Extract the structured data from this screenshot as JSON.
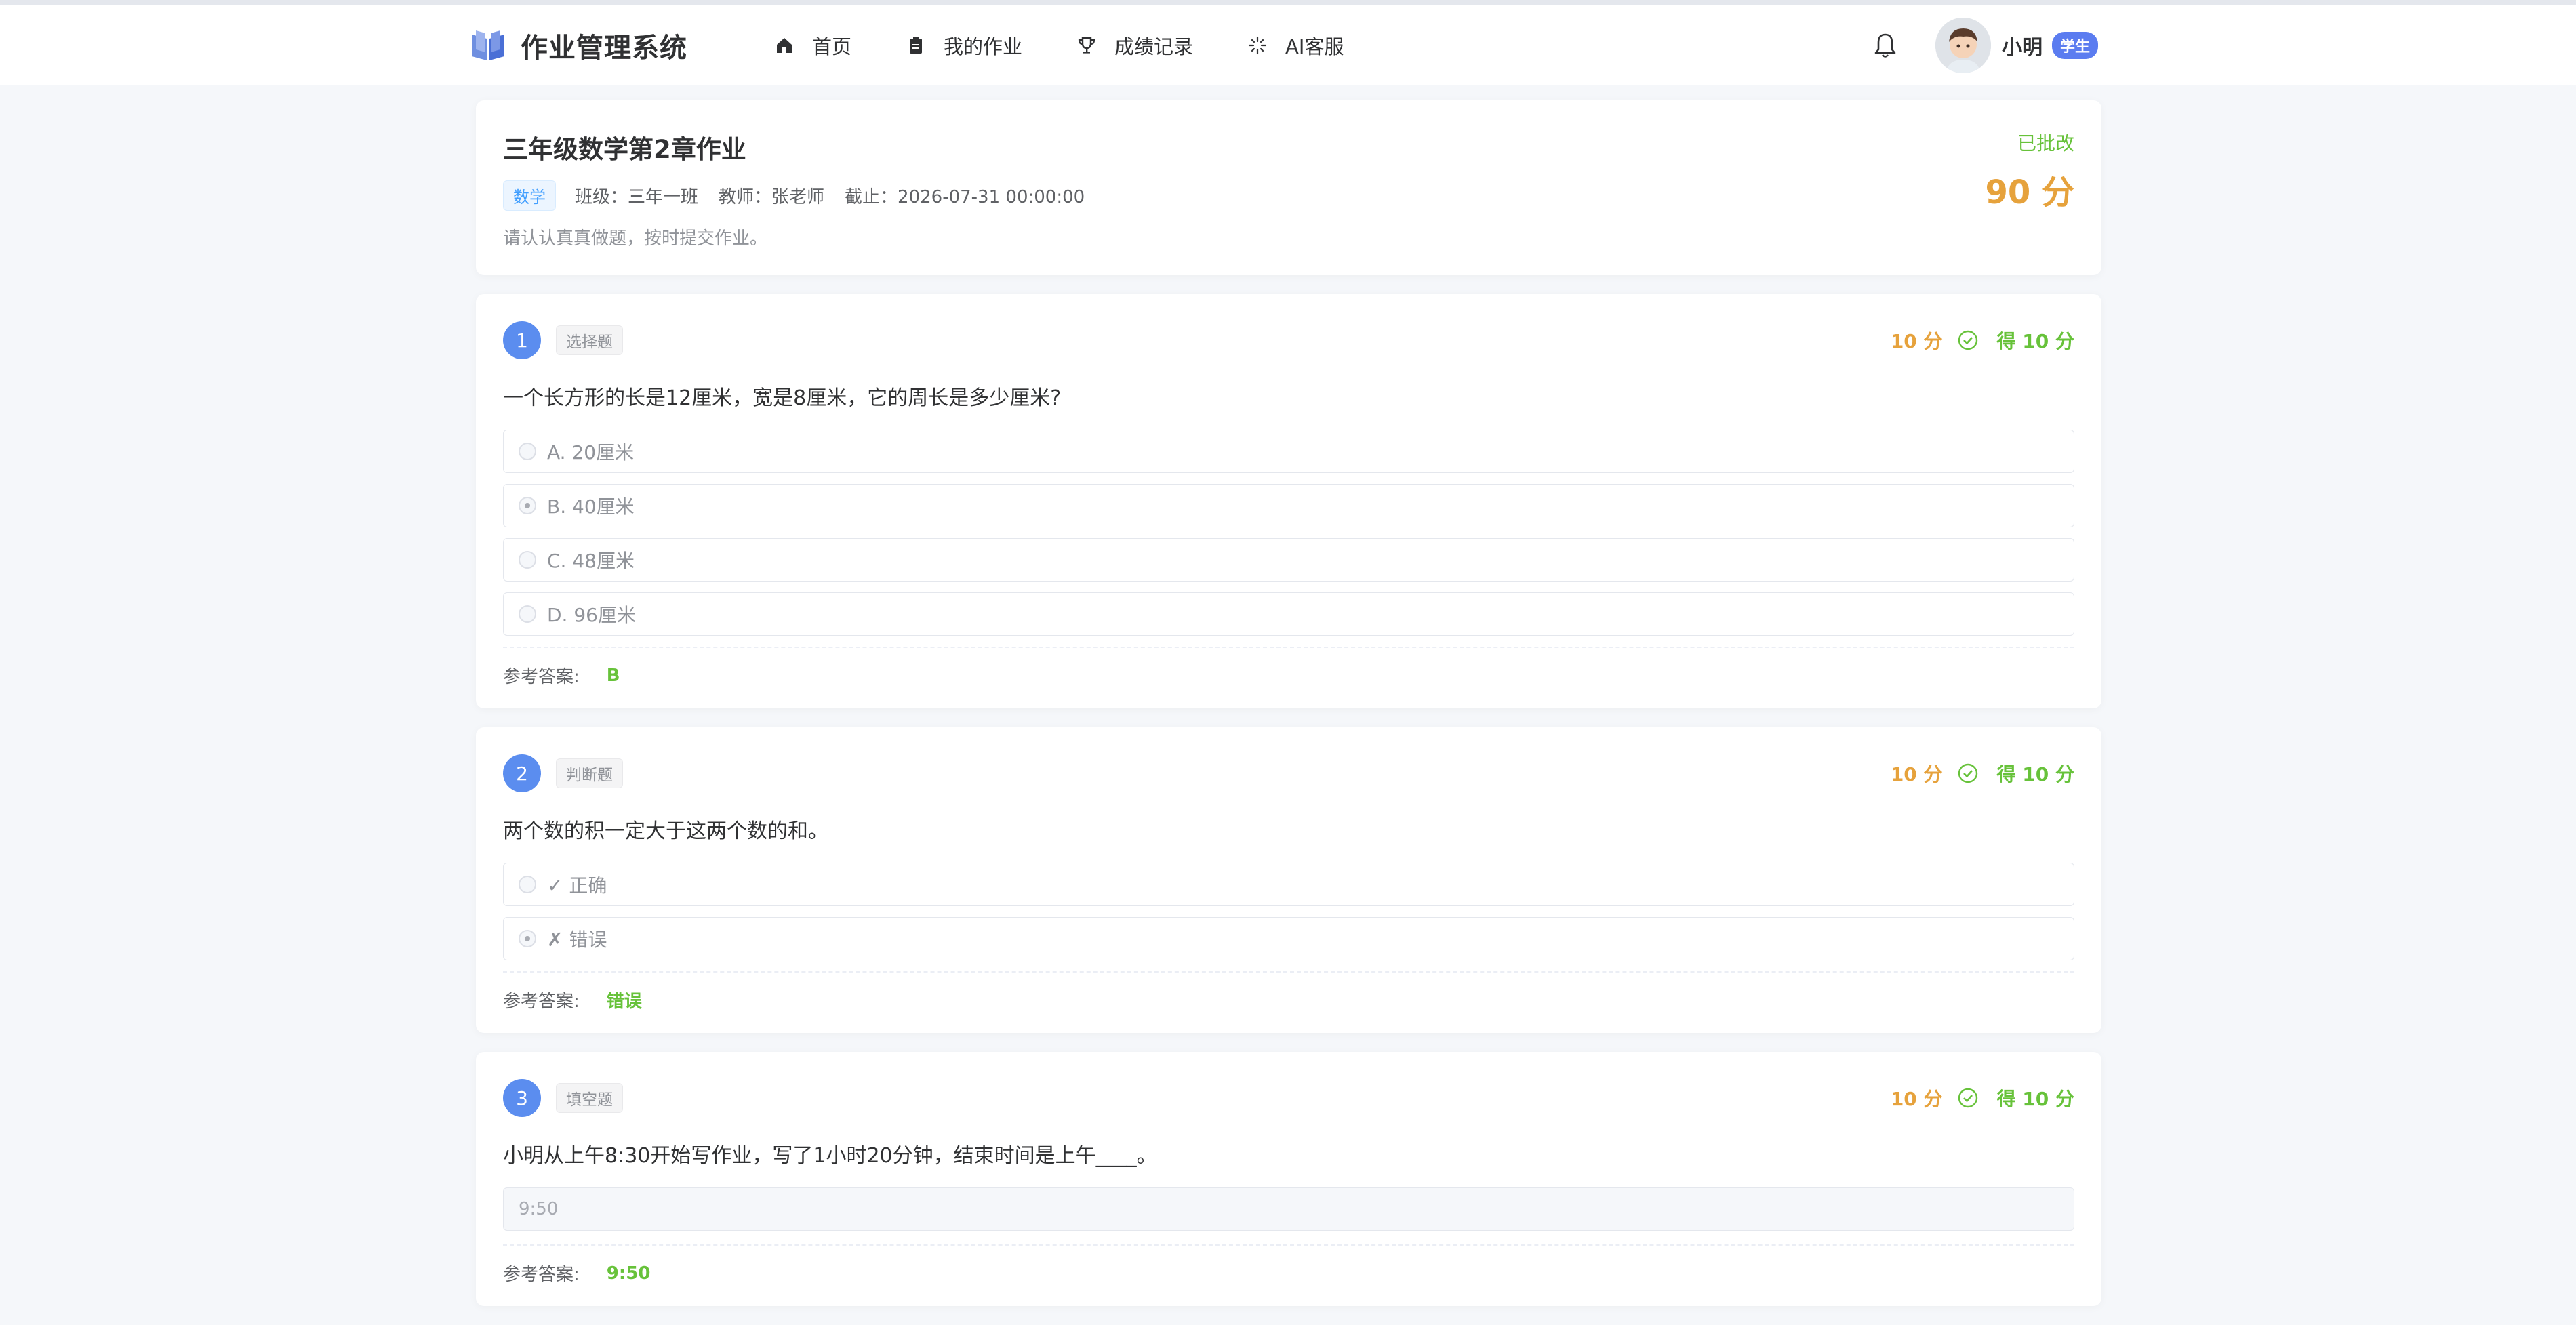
{
  "app": {
    "title": "作业管理系统",
    "colors": {
      "primary": "#5b8def",
      "success": "#67c23a",
      "warning": "#e6a23c",
      "badge": "#5b7cf0"
    }
  },
  "nav": {
    "items": [
      {
        "label": "首页",
        "icon": "home-icon"
      },
      {
        "label": "我的作业",
        "icon": "clipboard-icon"
      },
      {
        "label": "成绩记录",
        "icon": "trophy-icon"
      },
      {
        "label": "AI客服",
        "icon": "sparkle-icon"
      }
    ]
  },
  "user": {
    "name": "小明",
    "role": "学生"
  },
  "homework": {
    "title": "三年级数学第2章作业",
    "subject": "数学",
    "class_text": "班级：三年一班",
    "teacher_text": "教师：张老师",
    "deadline_text": "截止：2026-07-31 00:00:00",
    "description": "请认认真真做题，按时提交作业。",
    "status": "已批改",
    "score": "90 分"
  },
  "answer_label": "参考答案:",
  "questions": [
    {
      "number": "1",
      "type": "选择题",
      "points": "10 分",
      "earned": "得 10 分",
      "text": "一个长方形的长是12厘米，宽是8厘米，它的周长是多少厘米?",
      "options": [
        "A. 20厘米",
        "B. 40厘米",
        "C. 48厘米",
        "D. 96厘米"
      ],
      "selected_index": 1,
      "answer": "B"
    },
    {
      "number": "2",
      "type": "判断题",
      "points": "10 分",
      "earned": "得 10 分",
      "text": "两个数的积一定大于这两个数的和。",
      "options": [
        "✓ 正确",
        "✗ 错误"
      ],
      "selected_index": 1,
      "answer": "错误"
    },
    {
      "number": "3",
      "type": "填空题",
      "points": "10 分",
      "earned": "得 10 分",
      "text": "小明从上午8:30开始写作业，写了1小时20分钟，结束时间是上午____。",
      "student_answer": "9:50",
      "answer": "9:50"
    }
  ]
}
